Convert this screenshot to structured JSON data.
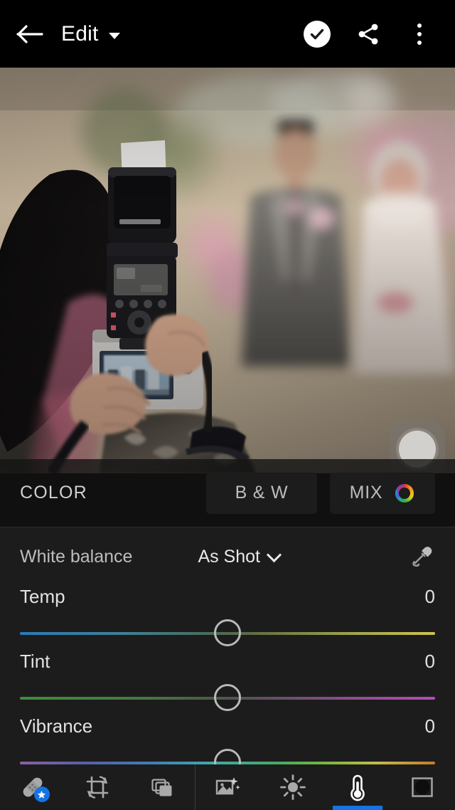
{
  "topbar": {
    "back_icon": "arrow-left-icon",
    "title": "Edit",
    "dropdown_icon": "caret-down-icon",
    "done_icon": "check-circle-icon",
    "share_icon": "share-icon",
    "overflow_icon": "kebab-menu-icon"
  },
  "photo": {
    "alt": "photographer-holding-camera-with-flash-shooting-wedding-couple",
    "compare_button_icon": "preview-circle-icon"
  },
  "color_header": {
    "title": "COLOR",
    "bw_label": "B & W",
    "mix_label": "MIX",
    "mix_icon": "color-wheel-icon"
  },
  "white_balance": {
    "label": "White balance",
    "value": "As Shot",
    "dropdown_icon": "chevron-down-icon",
    "eyedropper_icon": "eyedropper-icon"
  },
  "sliders": [
    {
      "name": "Temp",
      "value": "0",
      "thumb_pct": 50
    },
    {
      "name": "Tint",
      "value": "0",
      "thumb_pct": 50
    },
    {
      "name": "Vibrance",
      "value": "0",
      "thumb_pct": 50
    }
  ],
  "bottom_toolbar": {
    "items": [
      {
        "name": "healing-brush",
        "icon": "bandage-icon",
        "active": false,
        "badge": "star-badge"
      },
      {
        "name": "crop-rotate",
        "icon": "crop-rotate-icon",
        "active": false
      },
      {
        "name": "versions",
        "icon": "layers-stack-icon",
        "active": false
      },
      {
        "name": "presets",
        "icon": "image-sparkle-icon",
        "active": false
      },
      {
        "name": "light",
        "icon": "sun-icon",
        "active": false
      },
      {
        "name": "color",
        "icon": "thermometer-icon",
        "active": true
      },
      {
        "name": "effects",
        "icon": "vignette-icon",
        "active": false
      }
    ]
  },
  "colors": {
    "accent": "#1473e6",
    "panel_bg": "#1c1c1c",
    "topbar_bg": "#000000",
    "text_primary": "#e8e8e8",
    "text_secondary": "#bdbdbd",
    "icon_inactive": "#a8a8a8",
    "icon_active": "#ffffff"
  }
}
